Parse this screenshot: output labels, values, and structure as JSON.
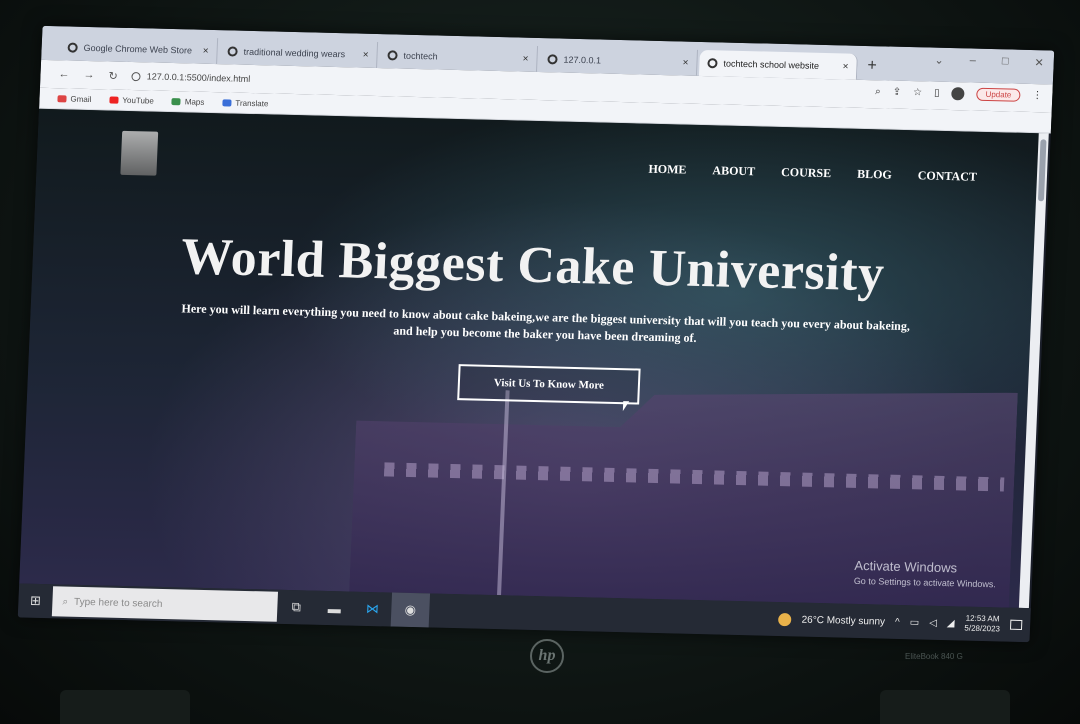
{
  "browser": {
    "tabs": [
      {
        "title": "Google Chrome Web Store",
        "close": "×"
      },
      {
        "title": "traditional wedding wears",
        "close": "×"
      },
      {
        "title": "tochtech",
        "close": "×"
      },
      {
        "title": "127.0.0.1",
        "close": "×"
      },
      {
        "title": "tochtech school website",
        "close": "×",
        "active": true
      }
    ],
    "new_tab": "+",
    "url": "127.0.0.1:5500/index.html",
    "update_label": "Update",
    "bookmarks": [
      "Gmail",
      "YouTube",
      "Maps",
      "Translate"
    ]
  },
  "site": {
    "nav": [
      "HOME",
      "ABOUT",
      "COURSE",
      "BLOG",
      "CONTACT"
    ],
    "title": "World Biggest Cake University",
    "text_line1": "Here you will learn everything you need to know about cake bakeing,we are the biggest university that will you teach you every about bakeing,",
    "text_line2": "and help you become the baker you have been dreaming of.",
    "cta": "Visit Us To Know More"
  },
  "watermark": {
    "title": "Activate Windows",
    "subtitle": "Go to Settings to activate Windows."
  },
  "taskbar": {
    "search_placeholder": "Type here to search",
    "weather": "26°C  Mostly sunny",
    "time": "12:53 AM",
    "date": "5/28/2023"
  },
  "hardware": {
    "brand": "hp",
    "model": "EliteBook 840 G"
  }
}
